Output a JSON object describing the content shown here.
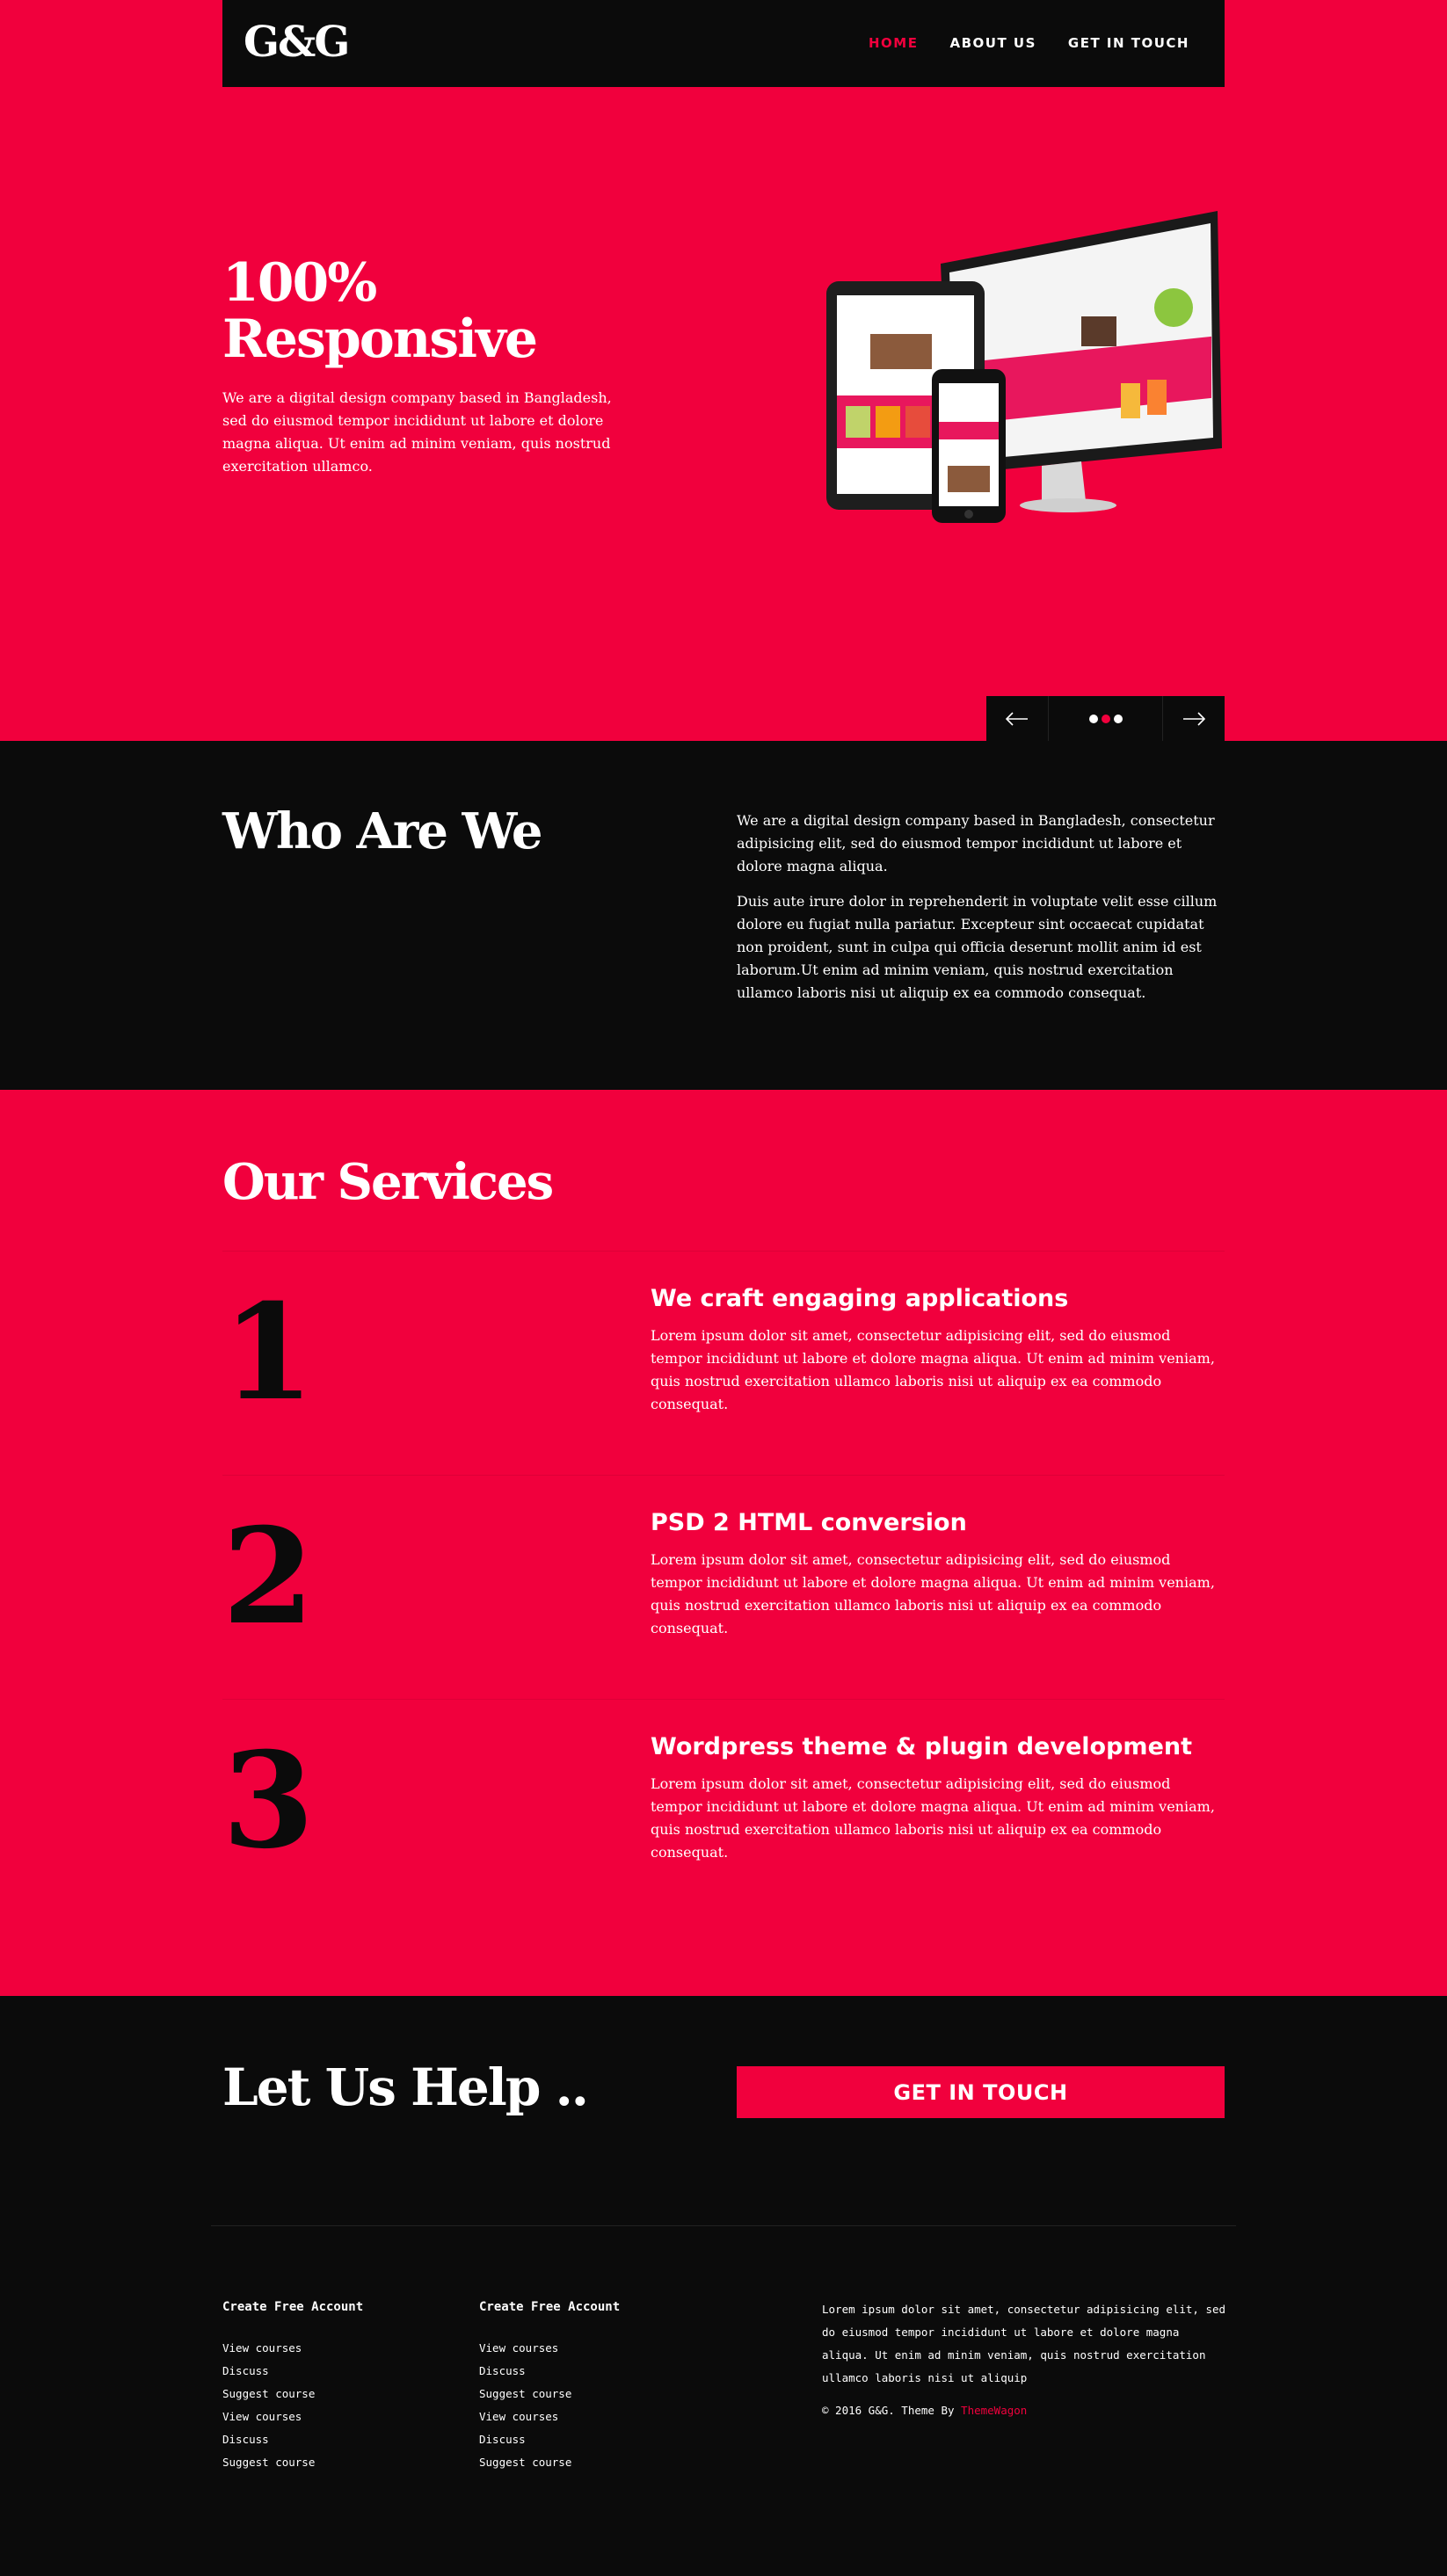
{
  "header": {
    "logo": "G&G",
    "nav": [
      "HOME",
      "ABOUT US",
      "GET IN TOUCH"
    ],
    "active_nav": "HOME"
  },
  "hero": {
    "title_line1": "100%",
    "title_line2": "Responsive",
    "text": "We are a digital design company based in Bangladesh, sed do eiusmod tempor incididunt ut labore et dolore magna aliqua. Ut enim ad minim veniam, quis nostrud exercitation ullamco.",
    "slider": {
      "dot_count": 3,
      "active_dot": 1
    }
  },
  "who": {
    "title": "Who Are We",
    "p1": "We are a digital design company based in Bangladesh, consectetur adipisicing elit, sed do eiusmod tempor incididunt ut labore et dolore magna aliqua.",
    "p2": "Duis aute irure dolor in reprehenderit in voluptate velit esse cillum dolore eu fugiat nulla pariatur. Excepteur sint occaecat cupidatat non proident, sunt in culpa qui officia deserunt mollit anim id est laborum.Ut enim ad minim veniam, quis nostrud exercitation ullamco laboris nisi ut aliquip ex ea commodo consequat."
  },
  "services": {
    "title": "Our Services",
    "items": [
      {
        "num": "1",
        "title": "We craft engaging applications",
        "text": "Lorem ipsum dolor sit amet, consectetur adipisicing elit, sed do eiusmod tempor incididunt ut labore et dolore magna aliqua. Ut enim ad minim veniam, quis nostrud exercitation ullamco laboris nisi ut aliquip ex ea commodo consequat."
      },
      {
        "num": "2",
        "title": "PSD 2 HTML conversion",
        "text": "Lorem ipsum dolor sit amet, consectetur adipisicing elit, sed do eiusmod tempor incididunt ut labore et dolore magna aliqua. Ut enim ad minim veniam, quis nostrud exercitation ullamco laboris nisi ut aliquip ex ea commodo consequat."
      },
      {
        "num": "3",
        "title": "Wordpress theme & plugin development",
        "text": "Lorem ipsum dolor sit amet, consectetur adipisicing elit, sed do eiusmod tempor incididunt ut labore et dolore magna aliqua. Ut enim ad minim veniam, quis nostrud exercitation ullamco laboris nisi ut aliquip ex ea commodo consequat."
      }
    ]
  },
  "help": {
    "title": "Let Us Help ..",
    "button": "GET IN TOUCH"
  },
  "footer": {
    "col1": {
      "title": "Create Free Account",
      "links": [
        "View courses",
        "Discuss",
        "Suggest course",
        "View courses",
        "Discuss",
        "Suggest course"
      ]
    },
    "col2": {
      "title": "Create Free Account",
      "links": [
        "View courses",
        "Discuss",
        "Suggest course",
        "View courses",
        "Discuss",
        "Suggest course"
      ]
    },
    "about": "Lorem ipsum dolor sit amet, consectetur adipisicing elit, sed do eiusmod tempor incididunt ut labore et dolore magna aliqua. Ut enim ad minim veniam, quis nostrud exercitation ullamco laboris nisi ut aliquip",
    "copyright": "© 2016 G&G. Theme By",
    "brand": "ThemeWagon"
  },
  "colors": {
    "accent": "#f1003d",
    "dark": "#0b0b0b",
    "text": "#ffffff"
  },
  "icons": [
    "arrow-left-icon",
    "arrow-right-icon"
  ]
}
